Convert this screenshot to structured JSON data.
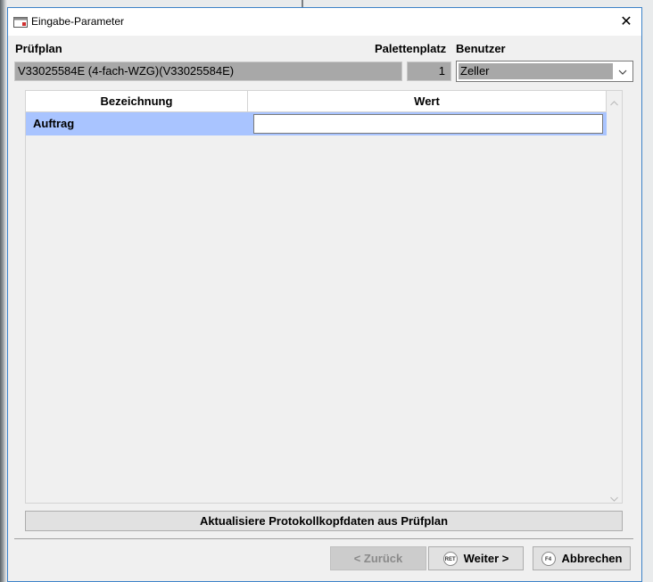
{
  "window": {
    "title": "Eingabe-Parameter",
    "close_symbol": "✕"
  },
  "header": {
    "pruefplan_label": "Prüfplan",
    "palettenplatz_label": "Palettenplatz",
    "benutzer_label": "Benutzer",
    "pruefplan_value": "V33025584E (4-fach-WZG)(V33025584E)",
    "palettenplatz_value": "1",
    "benutzer_value": "Zeller"
  },
  "grid": {
    "columns": [
      "Bezeichnung",
      "Wert"
    ],
    "rows": [
      {
        "bezeichnung": "Auftrag",
        "wert": ""
      }
    ]
  },
  "buttons": {
    "update": "Aktualisiere Protokollkopfdaten aus Prüfplan",
    "back": "< Zurück",
    "next": "Weiter >",
    "next_key": "RET",
    "cancel": "Abbrechen",
    "cancel_key": "F4"
  },
  "colors": {
    "selected_row": "#a9c4ff",
    "readonly_field": "#a8a8a8",
    "window_border": "#3c82c8"
  },
  "icons": {
    "app": "app-window-icon",
    "close": "close-icon",
    "dropdown": "chevron-down-icon",
    "scroll_up": "scroll-up-icon",
    "scroll_down": "scroll-down-icon"
  }
}
